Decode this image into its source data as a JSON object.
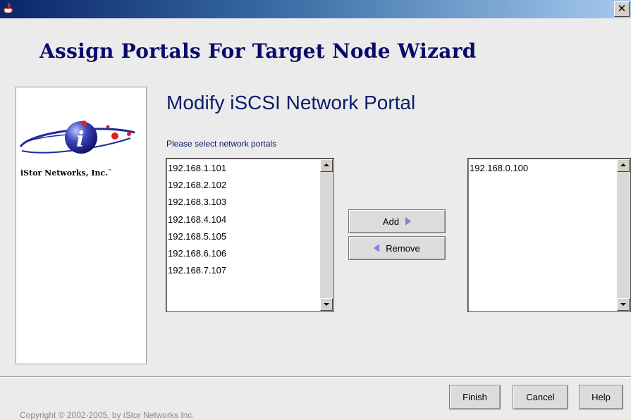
{
  "window": {
    "title": "",
    "close_symbol": "✕"
  },
  "wizard": {
    "title": "Assign Portals For Target Node Wizard",
    "step_title": "Modify iSCSI Network Portal",
    "list_caption": "Please select network portals"
  },
  "logo": {
    "company": "iStor Networks, Inc.",
    "trademark": "™",
    "icon": "istor-logo-icon"
  },
  "available_portals": [
    "192.168.1.101",
    "192.168.2.102",
    "192.168.3.103",
    "192.168.4.104",
    "192.168.5.105",
    "192.168.6.106",
    "192.168.7.107"
  ],
  "selected_portals": [
    "192.168.0.100"
  ],
  "buttons": {
    "add": "Add",
    "remove": "Remove",
    "finish": "Finish",
    "cancel": "Cancel",
    "help": "Help"
  },
  "footer": {
    "copyright": "Copyright © 2002-2005, by iStor Networks Inc."
  },
  "colors": {
    "title_blue": "#0a0a6a",
    "arrow_blue": "#7b86d6",
    "titlebar_dark": "#0a246a",
    "titlebar_light": "#a6caf0"
  }
}
